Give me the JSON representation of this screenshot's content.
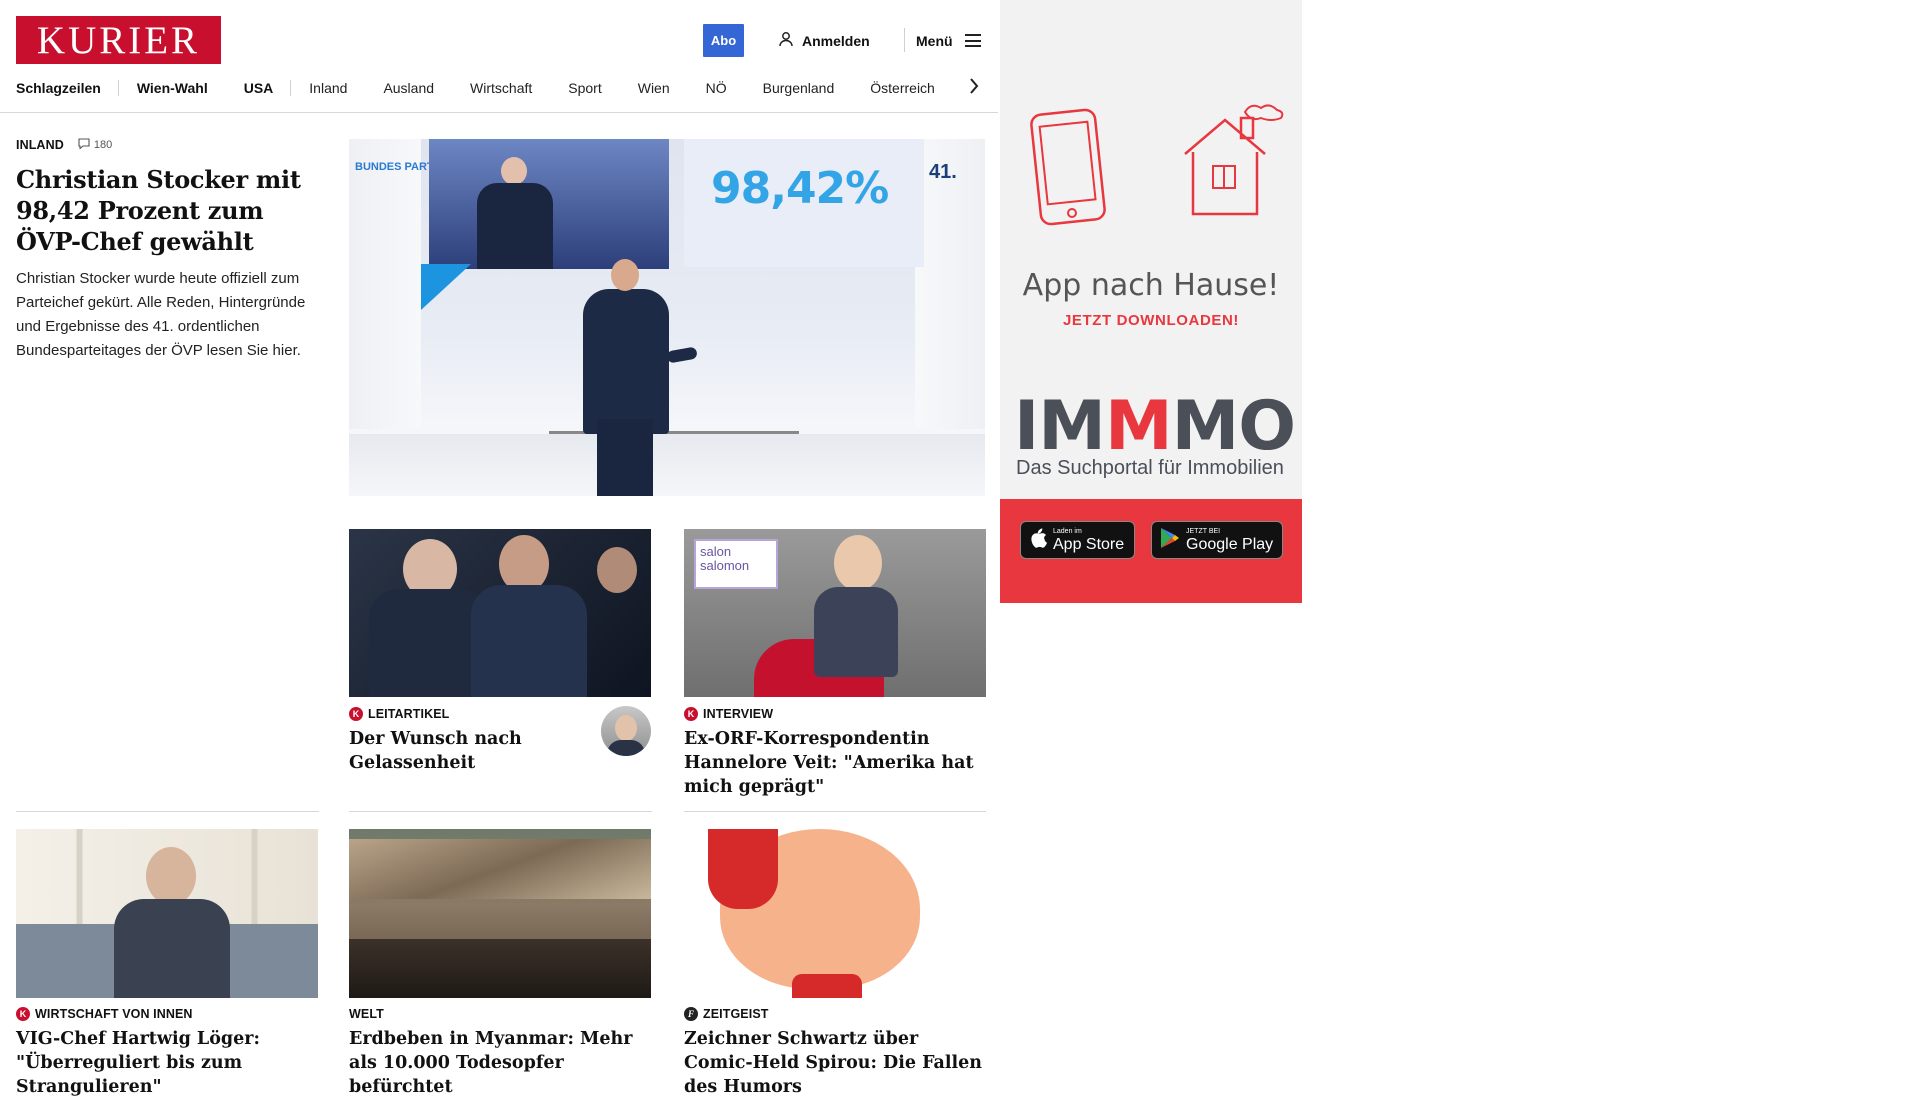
{
  "brand": {
    "logo_text": "KURIER",
    "logo_color": "#c8102e"
  },
  "header": {
    "abo_label": "Abo",
    "login_label": "Anmelden",
    "menu_label": "Menü"
  },
  "nav": {
    "items": [
      "Schlagzeilen",
      "Wien-Wahl",
      "USA",
      "Inland",
      "Ausland",
      "Wirtschaft",
      "Sport",
      "Wien",
      "NÖ",
      "Burgenland",
      "Österreich"
    ],
    "next_icon": "chevron-right-icon"
  },
  "lead_article": {
    "category": "INLAND",
    "comment_count": "180",
    "headline": "Christian Stocker mit 98,42 Prozent zum ÖVP-Chef gewählt",
    "teaser": "Christian Stocker wurde heute offiziell zum Parteichef gekürt. Alle Reden, Hintergründe und Ergebnisse des 41. ordentlichen Bundesparteitages der ÖVP lesen Sie hier.",
    "image_text": {
      "percent": "98,42%",
      "banner_left": "BUNDES PARTEITAG",
      "banner_right": "41."
    }
  },
  "articles": [
    {
      "kicker": "LEITARTIKEL",
      "badge": "K",
      "headline": "Der Wunsch nach Gelassenheit"
    },
    {
      "kicker": "INTERVIEW",
      "badge": "K",
      "headline": "Ex-ORF-Korrespondentin Hannelore Veit: \"Amerika hat mich geprägt\""
    },
    {
      "kicker": "WIRTSCHAFT VON INNEN",
      "badge": "K",
      "headline": "VIG-Chef Hartwig Löger: \"Überreguliert bis zum Strangulieren\""
    },
    {
      "kicker": "WELT",
      "badge": "",
      "headline": "Erdbeben in Myanmar: Mehr als 10.000 Todesopfer befürchtet"
    },
    {
      "kicker": "ZEITGEIST",
      "badge": "f",
      "headline": "Zeichner Schwartz über Comic-Held Spirou: Die Fallen des Humors"
    }
  ],
  "ad": {
    "title": "App nach Hause!",
    "cta": "JETZT DOWNLOADEN!",
    "brand_a": "IM",
    "brand_b": "M",
    "brand_c": "MO",
    "brand_sub": "Das Suchportal für Immobilien",
    "apple_small": "Laden im",
    "apple_big": "App Store",
    "google_small": "JETZT BEI",
    "google_big": "Google Play",
    "accent_color": "#e8373e"
  },
  "salon_label": "salon salomon"
}
